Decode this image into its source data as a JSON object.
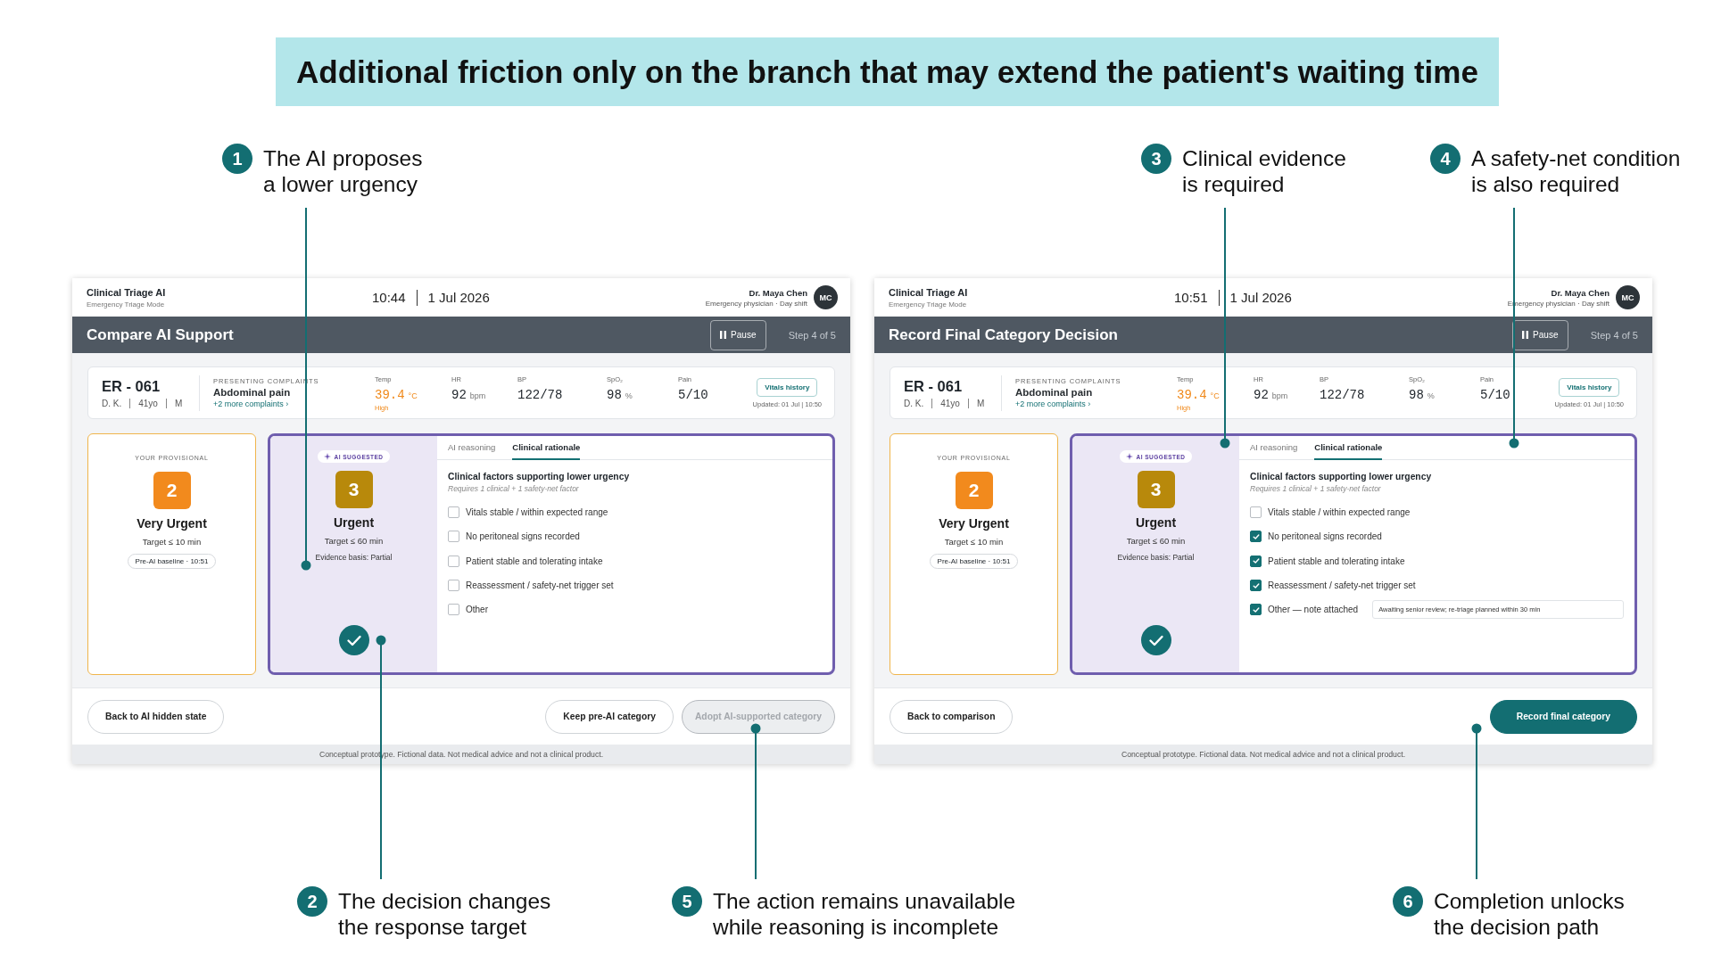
{
  "banner": "Additional friction only on the branch that may extend the patient's waiting time",
  "callouts": [
    {
      "number": "1",
      "lines": [
        "The AI proposes",
        "a lower urgency"
      ]
    },
    {
      "number": "2",
      "lines": [
        "The decision changes",
        "the response target"
      ]
    },
    {
      "number": "3",
      "lines": [
        "Clinical evidence",
        "is required"
      ]
    },
    {
      "number": "4",
      "lines": [
        "A safety-net condition",
        "is also required"
      ]
    },
    {
      "number": "5",
      "lines": [
        "The action remains unavailable",
        "while reasoning is incomplete"
      ]
    },
    {
      "number": "6",
      "lines": [
        "Completion unlocks",
        "the decision path"
      ]
    }
  ],
  "screens": [
    {
      "app_name": "Clinical Triage AI",
      "mode": "Emergency Triage Mode",
      "time": "10:44",
      "date": "1 Jul 2026",
      "user": {
        "name": "Dr. Maya Chen",
        "role": "Emergency physician · Day shift",
        "initials": "MC"
      },
      "page_title": "Compare AI Support",
      "pause_button": "Pause",
      "step": "Step 4 of 5",
      "patient": {
        "id": "ER - 061",
        "initials": "D. K.",
        "age": "41yo",
        "sex": "M",
        "complaints_label": "PRESENTING COMPLAINTS",
        "complaint": "Abdominal pain",
        "more_link": "+2 more complaints ›"
      },
      "vitals": [
        {
          "label": "Temp",
          "value": "39.4",
          "unit": "°C",
          "flag": "High",
          "abnormal": true
        },
        {
          "label": "HR",
          "value": "92",
          "unit": "bpm",
          "abnormal": false
        },
        {
          "label": "BP",
          "value": "122/78",
          "abnormal": false
        },
        {
          "label": "SpO₂",
          "value": "98",
          "unit": "%",
          "abnormal": false
        },
        {
          "label": "Pain",
          "value": "5/10",
          "abnormal": false
        }
      ],
      "vitals_button": "Vitals history",
      "vitals_updated": "Updated: 01 Jul | 10:50",
      "provisional": {
        "label": "YOUR PROVISIONAL",
        "category": "2",
        "color": "#f28a1d",
        "name": "Very Urgent",
        "target": "Target ≤ 10 min",
        "baseline": "Pre-AI baseline · 10:51"
      },
      "ai_suggestion": {
        "badge": "AI SUGGESTED",
        "category": "3",
        "color": "#b8890b",
        "name": "Urgent",
        "target": "Target ≤ 60 min",
        "evidence": "Evidence basis: Partial"
      },
      "tabs": [
        {
          "label": "AI reasoning",
          "selected": false
        },
        {
          "label": "Clinical rationale",
          "selected": true
        }
      ],
      "rationale": {
        "title": "Clinical factors supporting lower urgency",
        "requirement": "Requires 1 clinical + 1 safety-net factor",
        "factors": [
          {
            "label": "Vitals stable / within expected range",
            "checked": false
          },
          {
            "label": "No peritoneal signs recorded",
            "checked": false
          },
          {
            "label": "Patient stable and tolerating intake",
            "checked": false
          },
          {
            "label": "Reassessment / safety-net trigger set",
            "checked": false
          },
          {
            "label": "Other",
            "checked": false
          }
        ]
      },
      "footer": {
        "back_button": "Back to AI hidden state",
        "actions": [
          {
            "label": "Keep pre-AI category",
            "kind": "outline",
            "disabled": false
          },
          {
            "label": "Adopt AI-supported category",
            "kind": "outline",
            "disabled": true
          }
        ]
      },
      "disclaimer": "Conceptual prototype. Fictional data. Not medical advice and not a clinical product."
    },
    {
      "app_name": "Clinical Triage AI",
      "mode": "Emergency Triage Mode",
      "time": "10:51",
      "date": "1 Jul 2026",
      "user": {
        "name": "Dr. Maya Chen",
        "role": "Emergency physician · Day shift",
        "initials": "MC"
      },
      "page_title": "Record Final Category Decision",
      "pause_button": "Pause",
      "step": "Step 4 of 5",
      "patient": {
        "id": "ER - 061",
        "initials": "D. K.",
        "age": "41yo",
        "sex": "M",
        "complaints_label": "PRESENTING COMPLAINTS",
        "complaint": "Abdominal pain",
        "more_link": "+2 more complaints ›"
      },
      "vitals": [
        {
          "label": "Temp",
          "value": "39.4",
          "unit": "°C",
          "flag": "High",
          "abnormal": true
        },
        {
          "label": "HR",
          "value": "92",
          "unit": "bpm",
          "abnormal": false
        },
        {
          "label": "BP",
          "value": "122/78",
          "abnormal": false
        },
        {
          "label": "SpO₂",
          "value": "98",
          "unit": "%",
          "abnormal": false
        },
        {
          "label": "Pain",
          "value": "5/10",
          "abnormal": false
        }
      ],
      "vitals_button": "Vitals history",
      "vitals_updated": "Updated: 01 Jul | 10:50",
      "provisional": {
        "label": "YOUR PROVISIONAL",
        "category": "2",
        "color": "#f28a1d",
        "name": "Very Urgent",
        "target": "Target ≤ 10 min",
        "baseline": "Pre-AI baseline · 10:51"
      },
      "ai_suggestion": {
        "badge": "AI SUGGESTED",
        "category": "3",
        "color": "#b8890b",
        "name": "Urgent",
        "target": "Target ≤ 60 min",
        "evidence": "Evidence basis: Partial"
      },
      "tabs": [
        {
          "label": "AI reasoning",
          "selected": false
        },
        {
          "label": "Clinical rationale",
          "selected": true
        }
      ],
      "rationale": {
        "title": "Clinical factors supporting lower urgency",
        "requirement": "Requires 1 clinical + 1 safety-net factor",
        "factors": [
          {
            "label": "Vitals stable / within expected range",
            "checked": false
          },
          {
            "label": "No peritoneal signs recorded",
            "checked": true
          },
          {
            "label": "Patient stable and tolerating intake",
            "checked": true
          },
          {
            "label": "Reassessment / safety-net trigger set",
            "checked": true
          },
          {
            "label": "Other — note attached",
            "checked": true,
            "note": "Awaiting senior review; re-triage planned within 30 min"
          }
        ]
      },
      "footer": {
        "back_button": "Back to comparison",
        "actions": [
          {
            "label": "Record final category",
            "kind": "primary",
            "disabled": false
          }
        ]
      },
      "disclaimer": "Conceptual prototype. Fictional data. Not medical advice and not a clinical product."
    }
  ]
}
